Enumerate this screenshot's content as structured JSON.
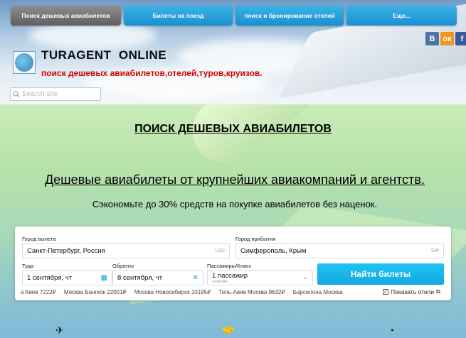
{
  "nav": [
    {
      "label": "Поиск дешевых авиабилетов",
      "active": true
    },
    {
      "label": "Билеты на поезд",
      "active": false
    },
    {
      "label": "поиск и бронирование отелей",
      "active": false
    },
    {
      "label": "Еще...",
      "active": false
    }
  ],
  "social": {
    "vk": "B",
    "ok": "ок",
    "fb": "f"
  },
  "site": {
    "title": "TURAGENT  ONLINE",
    "tagline": "поиск дешевых авиабилетов,отелей,туров,круизов.",
    "search_placeholder": "Search site"
  },
  "hero": {
    "title": "ПОИСК ДЕШЕВЫХ АВИАБИЛЕТОВ",
    "subtitle": "Дешевые авиабилеты от крупнейших авиакомпаний и агентств.",
    "note": "Сэкономьте до 30% средств на покупке авиабилетов без наценок."
  },
  "form": {
    "from_label": "Город вылета",
    "from_value": "Санкт-Петербург, Россия",
    "from_code": "LED",
    "to_label": "Город прибытия",
    "to_value": "Симферополь, Крым",
    "to_code": "SIP",
    "depart_label": "Туда",
    "depart_value": "1 сентября, чт",
    "return_label": "Обратно",
    "return_value": "8 сентября, чт",
    "pass_label": "Пассажиры/Класс",
    "pass_value": "1 пассажир",
    "pass_class": "эконом",
    "find_button": "Найти билеты",
    "routes": [
      "а  Киев 7222₽",
      "Москва  Бангкок 22001₽",
      "Москва  Новосибирск 10195₽",
      "Тель-Авив  Москва 9632₽",
      "Барселона  Москва"
    ],
    "show_hotels": "Показать отели"
  }
}
